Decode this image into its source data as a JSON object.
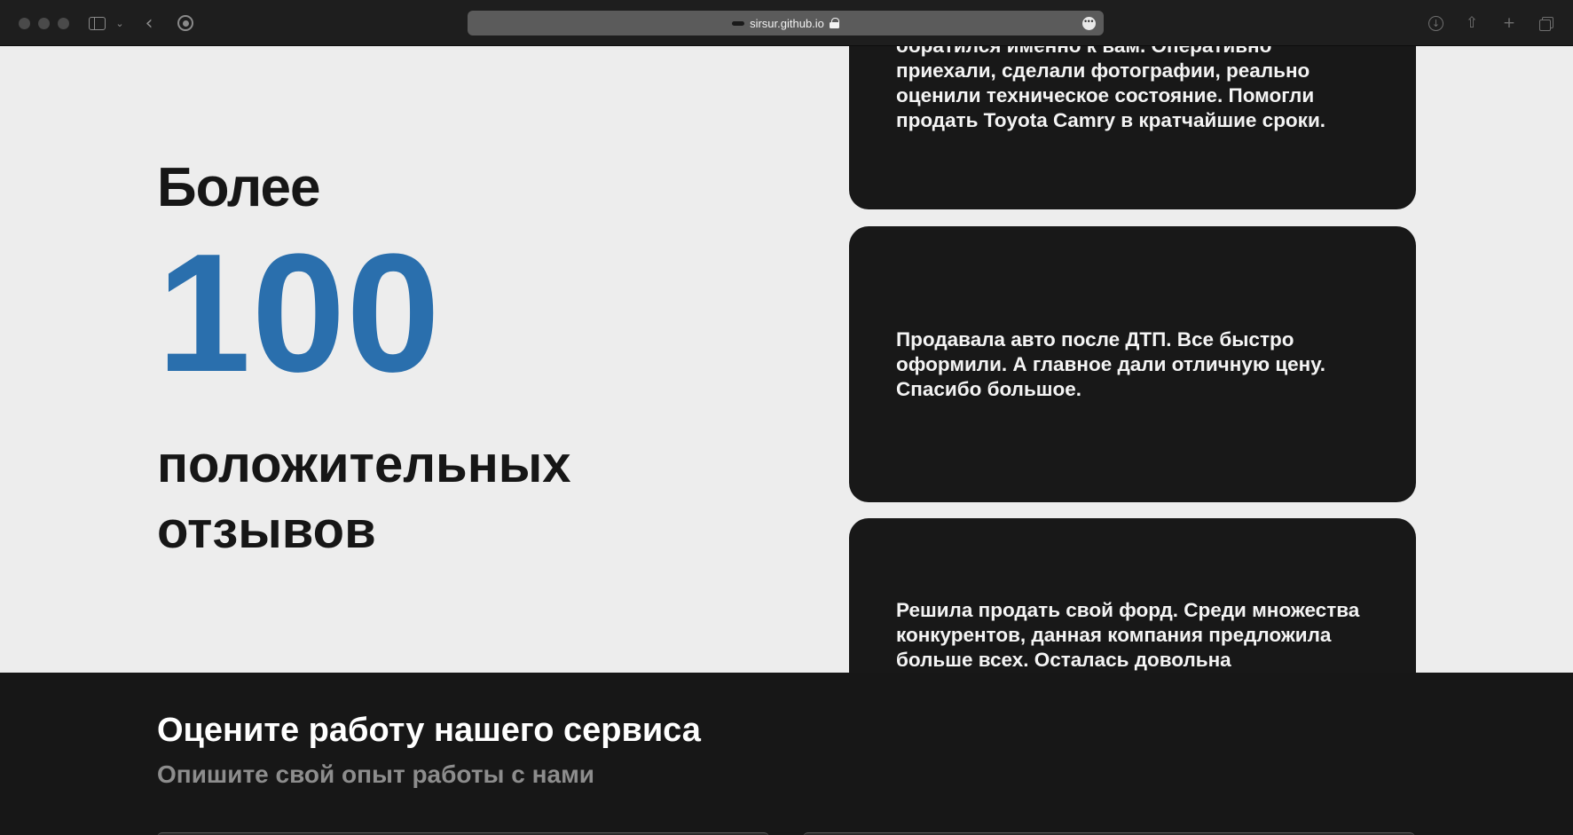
{
  "browser": {
    "url": "sirsur.github.io",
    "site_icon": "mustache-icon",
    "icons": [
      "sidebar-icon",
      "chevron-down-icon",
      "back-icon",
      "privacy-shield-icon",
      "lock-icon",
      "more-icon",
      "download-icon",
      "share-icon",
      "new-tab-icon",
      "tabs-overview-icon"
    ]
  },
  "stats": {
    "before": "Более",
    "number": "100",
    "after": "положительных отзывов"
  },
  "reviews": [
    {
      "text": "обратился именно к вам. Оперативно приехали, сделали фотографии, реально оценили техническое состояние. Помогли продать Toyota Camry в кратчайшие сроки."
    },
    {
      "text": "Продавала авто после ДТП. Все быстро оформили. А главное дали отличную цену. Спасибо большое."
    },
    {
      "text": "Решила продать свой форд. Среди множества конкурентов, данная компания предложила больше всех. Осталась довольна"
    }
  ],
  "rate": {
    "title": "Оцените работу нашего сервиса",
    "subtitle": "Опишите свой опыт работы с нами"
  },
  "colors": {
    "accent": "#2a6fad",
    "background": "#ededed",
    "card": "#181818",
    "section_dark": "#171717"
  }
}
